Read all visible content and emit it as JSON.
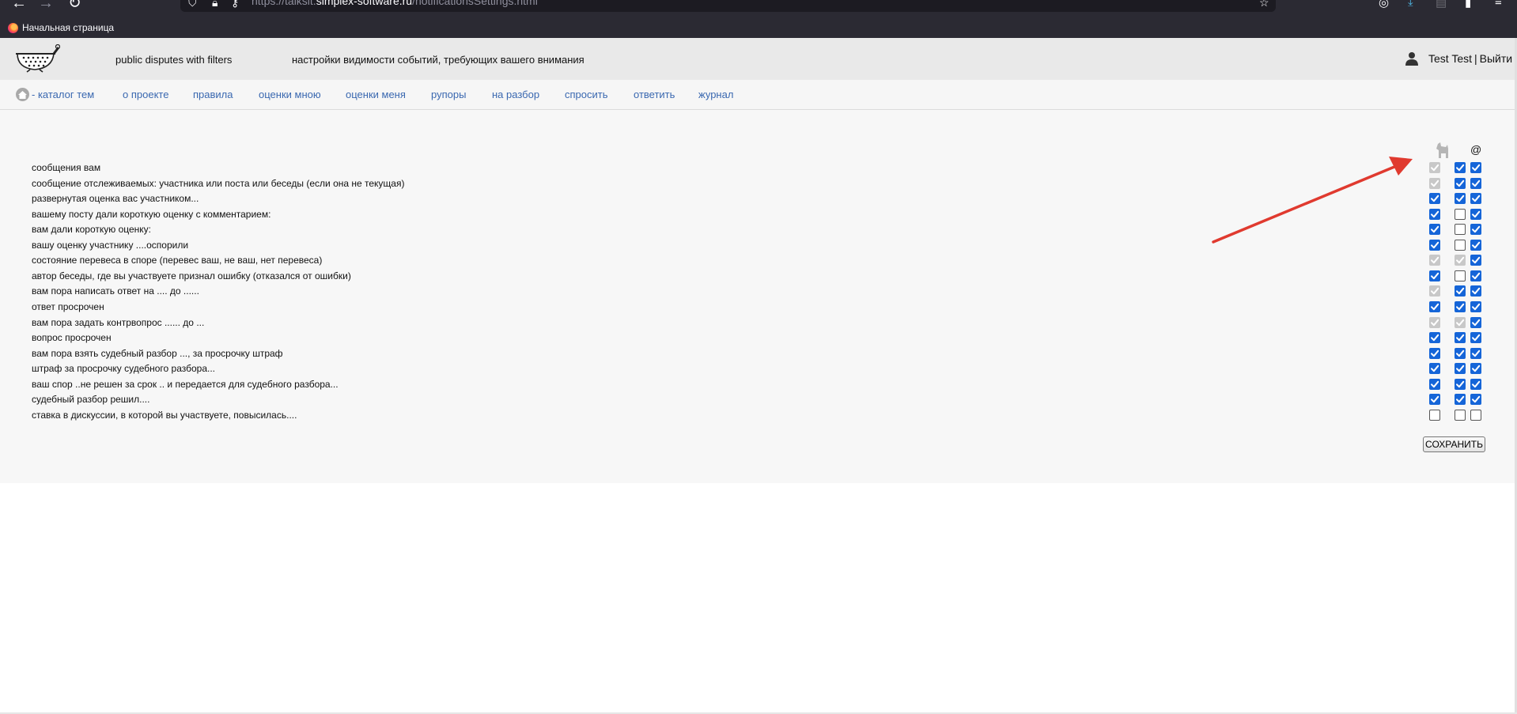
{
  "browser": {
    "url_prefix": "https://talksit.",
    "url_domain": "simplex-software.ru",
    "url_path": "/notificationsSettings.html",
    "bookmark": "Начальная страница"
  },
  "header": {
    "site_name": "public disputes with filters",
    "page_title": "настройки видимости событий, требующих вашего внимания",
    "user_name": "Test Test",
    "separator": "|",
    "logout": "Выйти"
  },
  "nav": {
    "home_label": "- каталог тем",
    "items": [
      "о проекте",
      "правила",
      "оценки мною",
      "оценки меня",
      "рупоры",
      "на разбор",
      "спросить",
      "ответить",
      "журнал"
    ]
  },
  "columns": {
    "col1_icon": "dog-icon",
    "col3_label": "@"
  },
  "rows": [
    {
      "label": "сообщения вам",
      "c1": "disabled",
      "c2": "on",
      "c3": "on"
    },
    {
      "label": "сообщение отслеживаемых: участника или поста или беседы (если она не текущая)",
      "c1": "disabled",
      "c2": "on",
      "c3": "on"
    },
    {
      "label": "развернутая оценка вас участником...",
      "c1": "on",
      "c2": "on",
      "c3": "on"
    },
    {
      "label": "вашему посту дали короткую оценку с комментарием:",
      "c1": "on",
      "c2": "off",
      "c3": "on"
    },
    {
      "label": "вам дали короткую оценку:",
      "c1": "on",
      "c2": "off",
      "c3": "on"
    },
    {
      "label": "вашу оценку участнику ....оспорили",
      "c1": "on",
      "c2": "off",
      "c3": "on"
    },
    {
      "label": "состояние перевеса в споре (перевес ваш, не ваш, нет перевеса)",
      "c1": "disabled",
      "c2": "disabled",
      "c3": "on"
    },
    {
      "label": "автор беседы, где вы участвуете признал ошибку (отказался от ошибки)",
      "c1": "on",
      "c2": "off",
      "c3": "on"
    },
    {
      "label": "вам пора написать ответ на .... до ......",
      "c1": "disabled",
      "c2": "on",
      "c3": "on"
    },
    {
      "label": "ответ просрочен",
      "c1": "on",
      "c2": "on",
      "c3": "on"
    },
    {
      "label": "вам пора задать контрвопрос ...... до ...",
      "c1": "disabled",
      "c2": "disabled",
      "c3": "on"
    },
    {
      "label": "вопрос просрочен",
      "c1": "on",
      "c2": "on",
      "c3": "on"
    },
    {
      "label": "вам пора взять судебный разбор ..., за просрочку штраф",
      "c1": "on",
      "c2": "on",
      "c3": "on"
    },
    {
      "label": "штраф за просрочку судебного разбора...",
      "c1": "on",
      "c2": "on",
      "c3": "on"
    },
    {
      "label": "ваш спор ..не решен за срок .. и передается для судебного разбора...",
      "c1": "on",
      "c2": "on",
      "c3": "on"
    },
    {
      "label": "судебный разбор решил....",
      "c1": "on",
      "c2": "on",
      "c3": "on"
    },
    {
      "label": "ставка в дискуссии, в которой вы участвуете, повысилась....",
      "c1": "off",
      "c2": "off",
      "c3": "off"
    }
  ],
  "save_label": "СОХРАНИТЬ",
  "colors": {
    "link": "#3a68b0",
    "checkbox_on": "#1565d8",
    "checkbox_disabled": "#c8c8c8",
    "arrow": "#e03a2f"
  }
}
